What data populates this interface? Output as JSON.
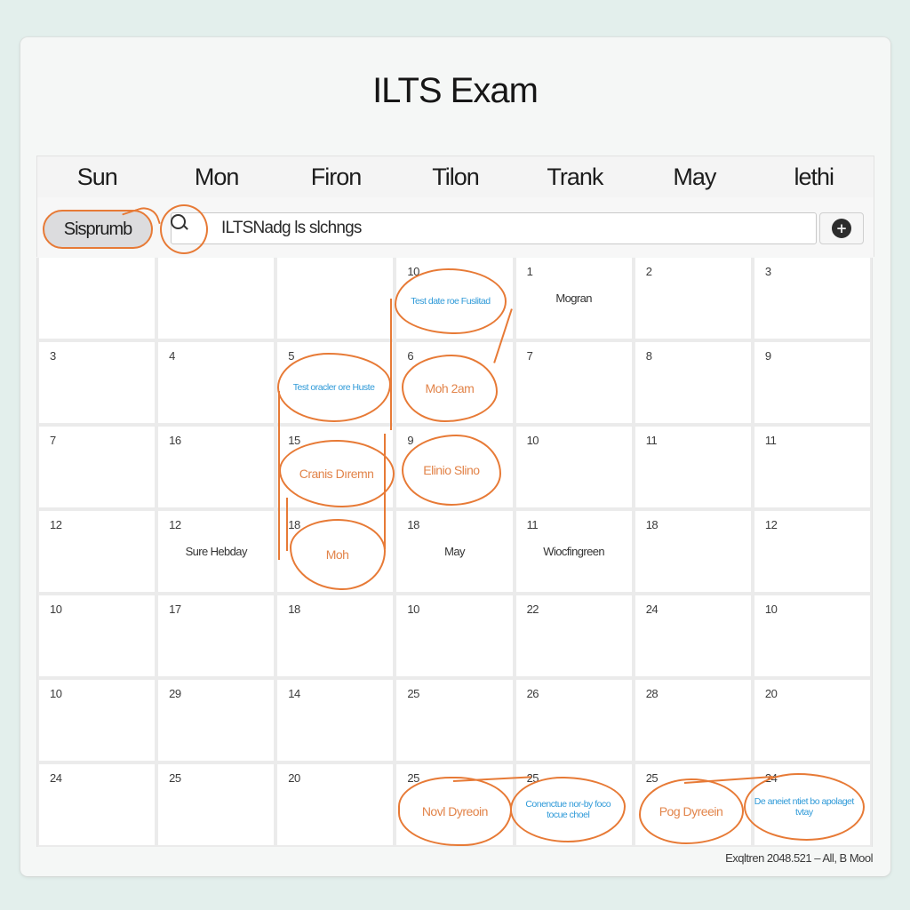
{
  "app": {
    "title": "ILTS Exam"
  },
  "header": {
    "days": [
      "Sun",
      "Mon",
      "Firon",
      "Tilon",
      "Trank",
      "May",
      "lethi"
    ]
  },
  "toolbar": {
    "filter_pill": "Sisprumb",
    "search_value": "ILTSNadg ls slchngs",
    "add_button_icon": "plus-circle-icon"
  },
  "calendar": {
    "rows": [
      [
        {
          "day": "",
          "event": ""
        },
        {
          "day": "",
          "event": ""
        },
        {
          "day": "",
          "event": ""
        },
        {
          "day": "10",
          "event": "Test date roe Fuslitad",
          "style": "blue-bubble"
        },
        {
          "day": "1",
          "event": "Mogran"
        },
        {
          "day": "2",
          "event": ""
        },
        {
          "day": "3",
          "event": ""
        }
      ],
      [
        {
          "day": "3",
          "event": ""
        },
        {
          "day": "4",
          "event": ""
        },
        {
          "day": "5",
          "event": "Test oracler ore Huste",
          "style": "blue-bubble"
        },
        {
          "day": "6",
          "event": "Moh 2am",
          "style": "orange-bubble"
        },
        {
          "day": "7",
          "event": ""
        },
        {
          "day": "8",
          "event": ""
        },
        {
          "day": "9",
          "event": ""
        }
      ],
      [
        {
          "day": "7",
          "event": ""
        },
        {
          "day": "16",
          "event": ""
        },
        {
          "day": "15",
          "event": "Cranis Dıremn",
          "style": "orange-bubble"
        },
        {
          "day": "9",
          "event": "Elinio Slino",
          "style": "orange-bubble"
        },
        {
          "day": "10",
          "event": ""
        },
        {
          "day": "11",
          "event": ""
        },
        {
          "day": "11",
          "event": ""
        }
      ],
      [
        {
          "day": "12",
          "event": ""
        },
        {
          "day": "12",
          "event": "Sure Hebday"
        },
        {
          "day": "18",
          "event": "Moh",
          "style": "orange-bubble"
        },
        {
          "day": "18",
          "event": "May"
        },
        {
          "day": "11",
          "event": "Wiocfingreen"
        },
        {
          "day": "18",
          "event": ""
        },
        {
          "day": "12",
          "event": ""
        }
      ],
      [
        {
          "day": "10",
          "event": ""
        },
        {
          "day": "17",
          "event": ""
        },
        {
          "day": "18",
          "event": ""
        },
        {
          "day": "10",
          "event": ""
        },
        {
          "day": "22",
          "event": ""
        },
        {
          "day": "24",
          "event": ""
        },
        {
          "day": "10",
          "event": ""
        }
      ],
      [
        {
          "day": "10",
          "event": ""
        },
        {
          "day": "29",
          "event": ""
        },
        {
          "day": "14",
          "event": ""
        },
        {
          "day": "25",
          "event": ""
        },
        {
          "day": "26",
          "event": ""
        },
        {
          "day": "28",
          "event": ""
        },
        {
          "day": "20",
          "event": ""
        }
      ],
      [
        {
          "day": "24",
          "event": ""
        },
        {
          "day": "25",
          "event": ""
        },
        {
          "day": "20",
          "event": ""
        },
        {
          "day": "25",
          "event": "Novl Dyreoin",
          "style": "orange-bubble"
        },
        {
          "day": "25",
          "event": "Conenctue nor-by foco tocue choel",
          "style": "blue-bubble"
        },
        {
          "day": "25",
          "event": "Pog Dyreein",
          "style": "orange-bubble"
        },
        {
          "day": "24",
          "event": "De aneiet ntiet bo apolaget tvtay",
          "style": "blue-bubble"
        }
      ]
    ]
  },
  "footer": {
    "text": "Exqltren 2048.521  – All, B Mool"
  },
  "colors": {
    "annotation": "#e77a36",
    "event_blue": "#2f9ad8",
    "event_orange": "#e2844a",
    "background": "#e3efec"
  }
}
